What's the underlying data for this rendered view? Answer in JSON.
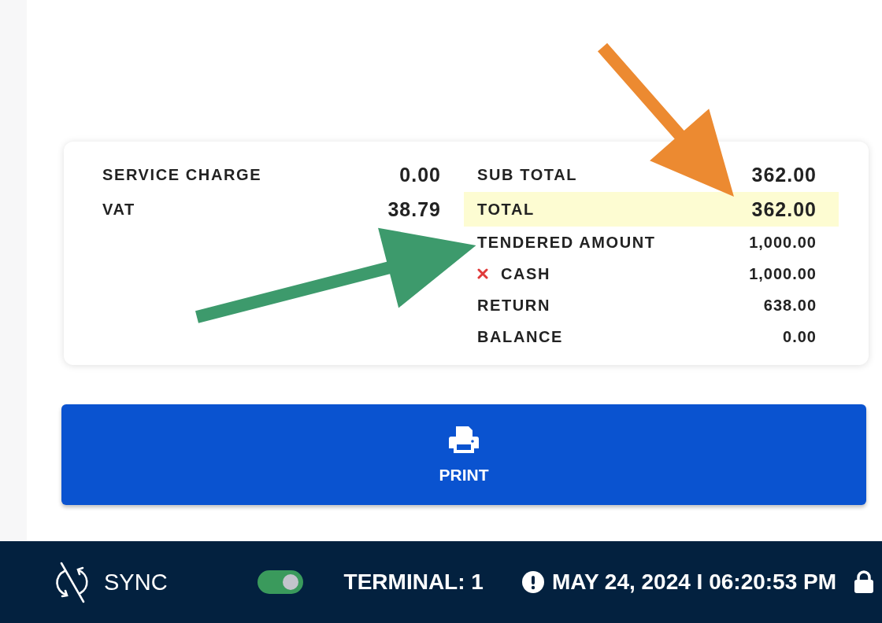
{
  "summary": {
    "left_rows": [
      {
        "label": "SERVICE CHARGE",
        "value": "0.00"
      },
      {
        "label": "VAT",
        "value": "38.79"
      }
    ],
    "right_rows": [
      {
        "kind": "subtotal",
        "label": "SUB TOTAL",
        "value": "362.00",
        "highlighted": false
      },
      {
        "kind": "total",
        "label": "TOTAL",
        "value": "362.00",
        "highlighted": true
      },
      {
        "kind": "line",
        "label": "TENDERED AMOUNT",
        "value": "1,000.00",
        "highlighted": false
      },
      {
        "kind": "payment",
        "label": "CASH",
        "value": "1,000.00",
        "highlighted": false
      },
      {
        "kind": "line",
        "label": "RETURN",
        "value": "638.00",
        "highlighted": false
      },
      {
        "kind": "line",
        "label": "BALANCE",
        "value": "0.00",
        "highlighted": false
      }
    ]
  },
  "print_button": {
    "label": "PRINT"
  },
  "status_bar": {
    "sync_label": "SYNC",
    "sync_toggle": {
      "on": true
    },
    "terminal": "TERMINAL: 1",
    "datetime": "MAY 24, 2024 I 06:20:53 PM"
  },
  "annotations": [
    {
      "kind": "arrow",
      "color": "#ec8a31"
    },
    {
      "kind": "arrow",
      "color": "#3d9a6c"
    }
  ]
}
